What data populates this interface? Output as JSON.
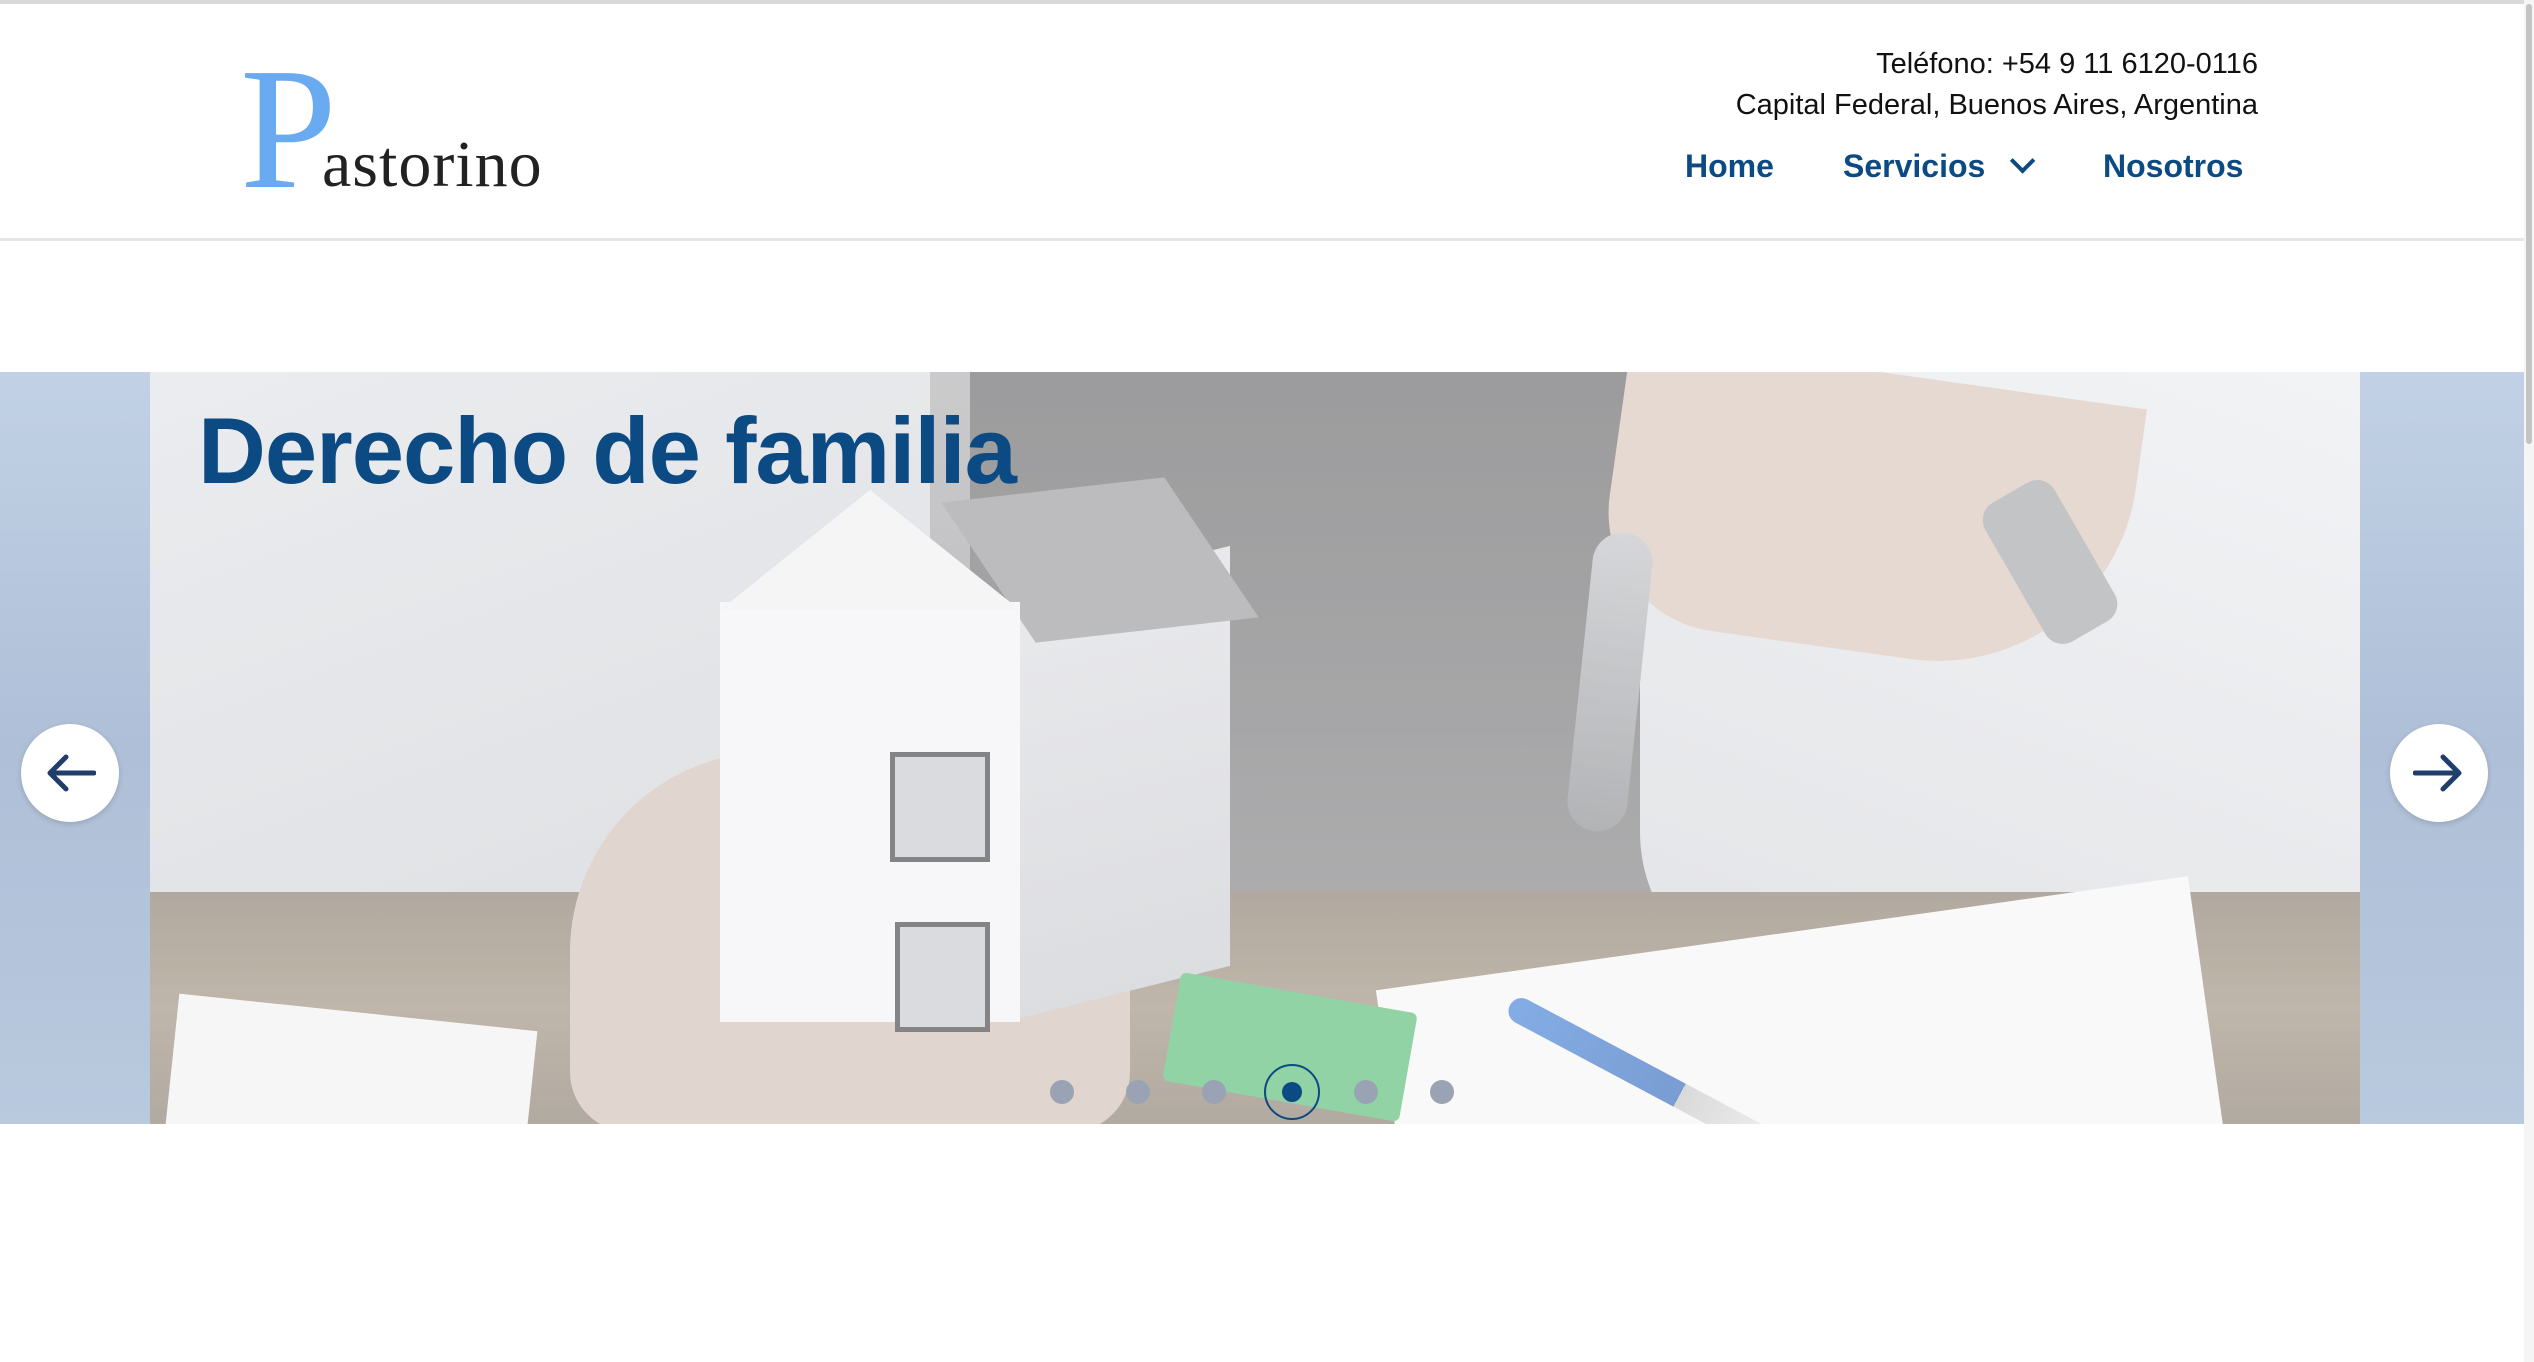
{
  "brand": {
    "logo_initial": "P",
    "logo_rest": "astorino",
    "logo_initial_color": "#6aaaf0"
  },
  "contact": {
    "phone": "Teléfono: +54 9 11 6120-0116",
    "address": "Capital Federal, Buenos Aires, Argentina"
  },
  "nav": {
    "items": [
      {
        "label": "Home"
      },
      {
        "label": "Servicios",
        "icon": "chevron-down-icon"
      },
      {
        "label": "Nosotros"
      }
    ],
    "color": "#0c4a83"
  },
  "slider": {
    "current_title": "Derecho de familia",
    "title_color": "#0c4a83",
    "prev_icon": "arrow-left-icon",
    "next_icon": "arrow-right-icon",
    "dots_count": 6,
    "active_dot_index": 3
  }
}
